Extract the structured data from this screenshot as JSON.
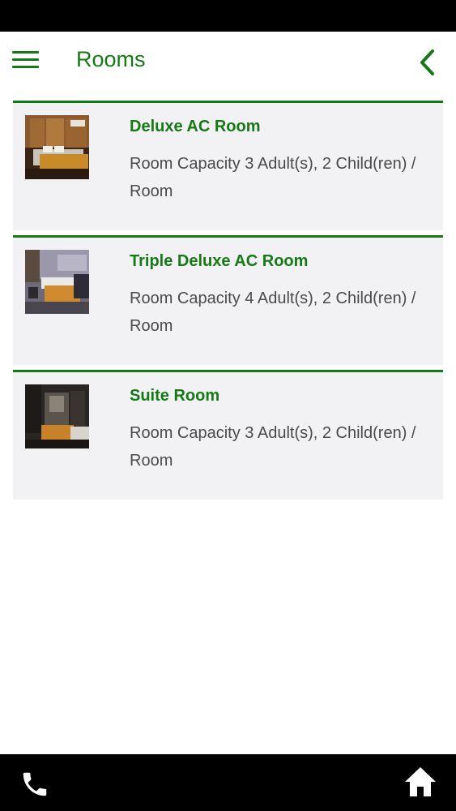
{
  "header": {
    "title": "Rooms",
    "menu_icon": "hamburger-menu-icon",
    "back_icon": "chevron-left-icon"
  },
  "rooms": [
    {
      "name": "Deluxe AC Room",
      "capacity": "Room Capacity 3 Adult(s), 2 Child(ren) / Room"
    },
    {
      "name": "Triple Deluxe AC Room",
      "capacity": "Room Capacity 4 Adult(s), 2 Child(ren) / Room"
    },
    {
      "name": "Suite Room",
      "capacity": "Room Capacity 3 Adult(s), 2 Child(ren) / Room"
    }
  ],
  "bottom_bar": {
    "call_icon": "phone-icon",
    "home_icon": "home-icon"
  },
  "colors": {
    "accent": "#157a15",
    "card_background": "#f2f2f4",
    "body_text": "#4a4a4a",
    "bars": "#000000"
  }
}
